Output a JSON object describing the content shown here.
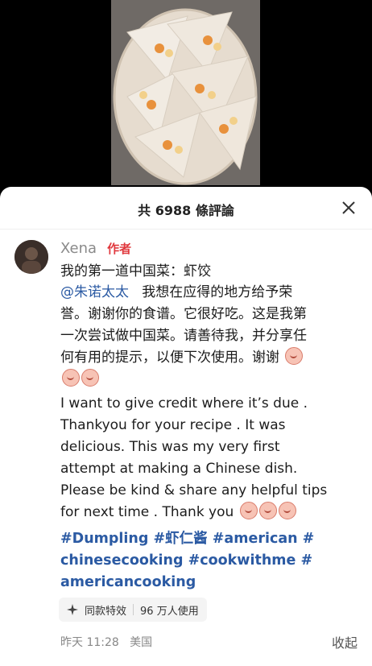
{
  "sheet": {
    "title": "共 6988 條評論",
    "close_icon": "close-icon"
  },
  "comment": {
    "author": "Xena",
    "author_badge": "作者",
    "zh_title": "我的第一道中国菜：虾饺",
    "mention": "@朱诺太太",
    "zh_body_1": "我想在应得的地方给予荣",
    "zh_body_2": "誉。谢谢你的食谱。它很好吃。这是我第",
    "zh_body_3": "一次尝试做中国菜。请善待我，并分享任",
    "zh_body_4": "何有用的提示，以便下次使用。谢谢",
    "en_1": "I want to give credit where it’s due .",
    "en_2": "Thankyou for your recipe . It was",
    "en_3": "delicious. This was my very first",
    "en_4": "attempt at making a Chinese dish.",
    "en_5": "Please be kind & share any helpful tips",
    "en_6": "for next time . Thank you",
    "tags_1": "#Dumpling #虾仁酱 #american #",
    "tags_2": "chinesecooking #cookwithme #",
    "tags_3": "americancooking",
    "effect_label": "同款特效",
    "effect_users": "96 万人使用",
    "time": "昨天 11:28",
    "location": "美国",
    "collapse": "收起"
  },
  "colors": {
    "accent_badge": "#e0393e",
    "link": "#2b5aa3"
  }
}
